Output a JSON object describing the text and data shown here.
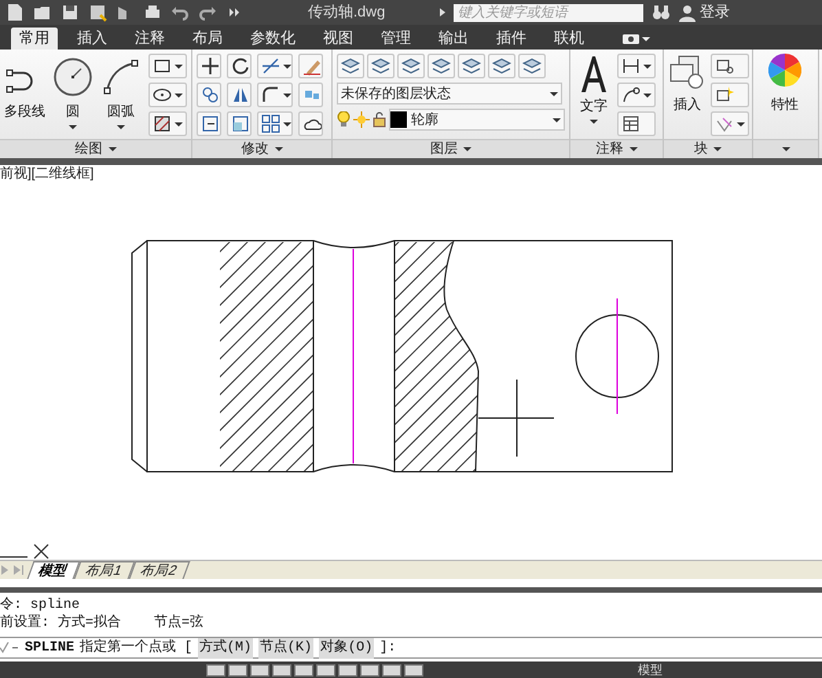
{
  "title_bar": {
    "title": "传动轴.dwg",
    "search": {
      "placeholder": "键入关键字或短语"
    },
    "login": "登录"
  },
  "ribbon_tabs": [
    {
      "label": "常用",
      "selected": true
    },
    {
      "label": "插入",
      "selected": false
    },
    {
      "label": "注释",
      "selected": false
    },
    {
      "label": "布局",
      "selected": false
    },
    {
      "label": "参数化",
      "selected": false
    },
    {
      "label": "视图",
      "selected": false
    },
    {
      "label": "管理",
      "selected": false
    },
    {
      "label": "输出",
      "selected": false
    },
    {
      "label": "插件",
      "selected": false
    },
    {
      "label": "联机",
      "selected": false
    }
  ],
  "ribbon": {
    "draw": {
      "title": "绘图",
      "tools": [
        {
          "label": "多段线",
          "kind": "polyline"
        },
        {
          "label": "圆",
          "kind": "circle"
        },
        {
          "label": "圆弧",
          "kind": "arc"
        }
      ]
    },
    "modify": {
      "title": "修改"
    },
    "layers": {
      "title": "图层",
      "layer_state": "未保存的图层状态",
      "current_layer": "轮廓"
    },
    "annotation": {
      "title": "注释",
      "text_tool": "文字"
    },
    "block": {
      "title": "块",
      "insert_tool": "插入"
    },
    "properties": {
      "label": "特性"
    }
  },
  "viewport": {
    "label": "前视][二维线框]"
  },
  "layout_tabs": [
    {
      "label": "模型",
      "selected": true
    },
    {
      "label": "布局1",
      "selected": false
    },
    {
      "label": "布局2",
      "selected": false
    }
  ],
  "command_line": {
    "history": [
      "令: spline",
      "前设置: 方式=拟合    节点=弦"
    ],
    "command": "SPLINE",
    "prompt": "指定第一个点或 [",
    "options": [
      "方式(M)",
      "节点(K)",
      "对象(O)"
    ],
    "prompt_end": "]:"
  },
  "status_bar": {
    "space": "模型"
  }
}
